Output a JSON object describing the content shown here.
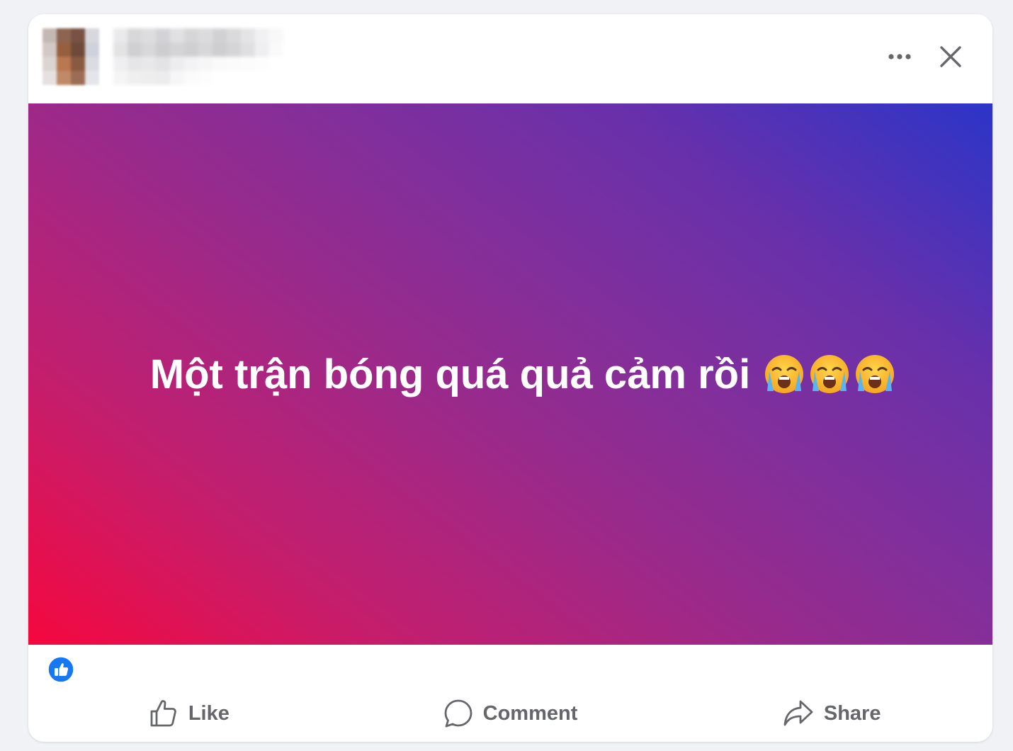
{
  "header": {
    "more_icon": "more-horizontal-icon",
    "close_icon": "close-icon"
  },
  "post": {
    "text": "Một trận bóng quá quả cảm rồi",
    "emoji": "crying-face",
    "emoji_count": 3,
    "background_gradient": [
      "#f5083e",
      "#c41e6d",
      "#992a8b",
      "#822f9b",
      "#6730ab",
      "#2b35c8"
    ]
  },
  "reactions": {
    "icon": "like-reaction-icon",
    "color": "#1877f2"
  },
  "actions": {
    "like_label": "Like",
    "comment_label": "Comment",
    "share_label": "Share"
  },
  "colors": {
    "page_bg": "#f0f2f5",
    "card_bg": "#ffffff",
    "action_text": "#65676b"
  }
}
